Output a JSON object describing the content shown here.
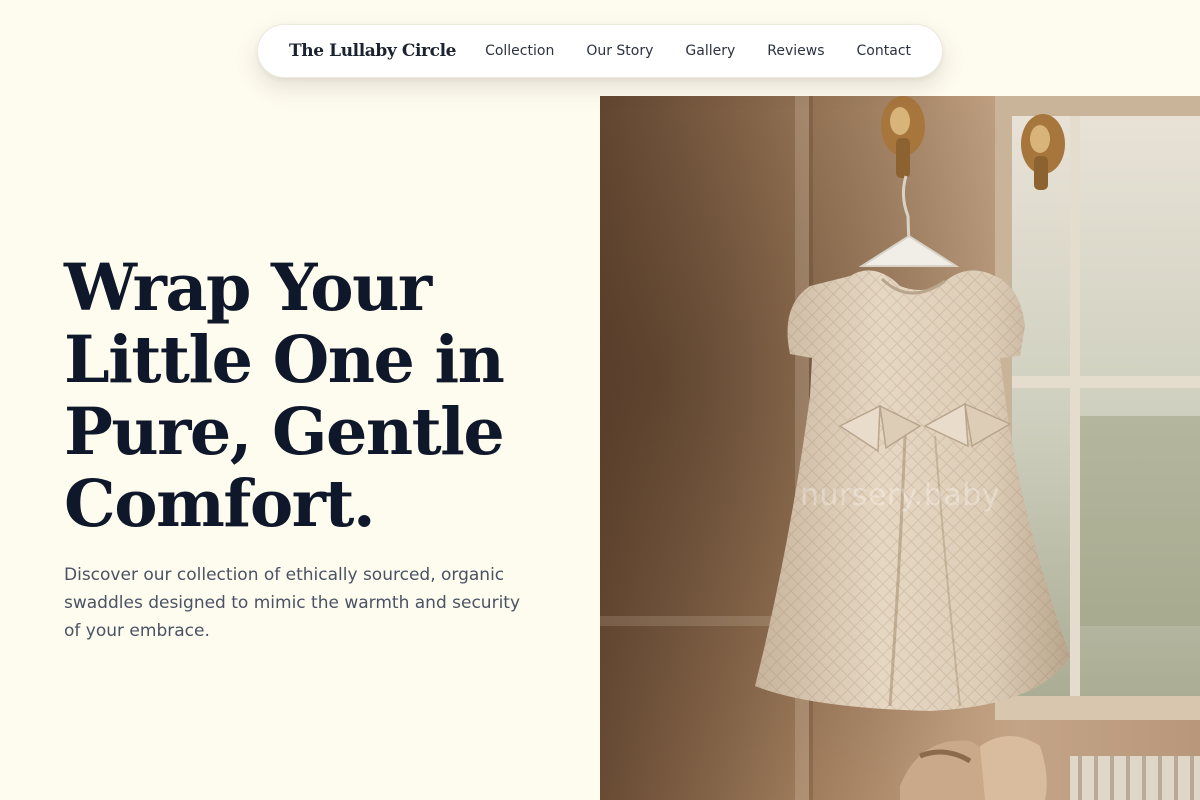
{
  "brand": "The Lullaby Circle",
  "nav": {
    "links": [
      "Collection",
      "Our Story",
      "Gallery",
      "Reviews",
      "Contact"
    ]
  },
  "hero": {
    "title": "Wrap Your Little One in Pure, Gentle Comfort.",
    "subtitle": "Discover our collection of ethically sourced, organic swaddles designed to mimic the warmth and security of your embrace.",
    "image_description": "nursery.baby",
    "watermark": "nursery.baby"
  },
  "colors": {
    "background": "#fefcef",
    "heading": "#0f172a",
    "body_text": "#4a5264",
    "nav_background": "#ffffff"
  }
}
